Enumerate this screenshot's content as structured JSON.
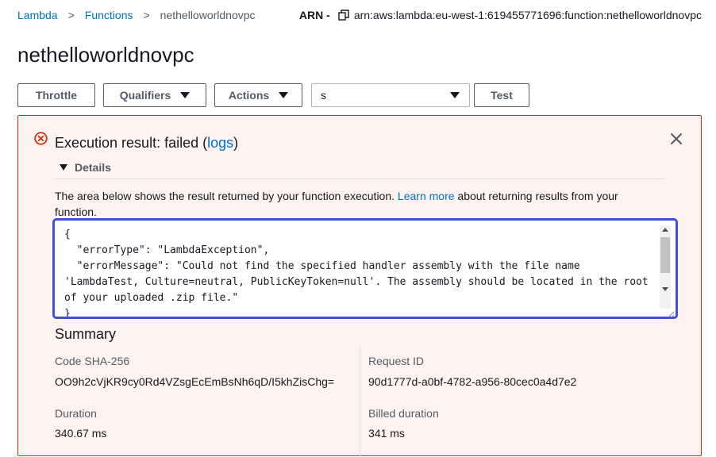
{
  "breadcrumb": {
    "items": [
      "Lambda",
      "Functions"
    ],
    "current": "nethelloworldnovpc",
    "separator": ">"
  },
  "arn": {
    "label": "ARN -",
    "value": "arn:aws:lambda:eu-west-1:619455771696:function:nethelloworldnovpc",
    "icon": "copy-icon"
  },
  "page": {
    "title": "nethelloworldnovpc"
  },
  "toolbar": {
    "throttle_label": "Throttle",
    "qualifiers_label": "Qualifiers",
    "actions_label": "Actions",
    "test_event_selected": "s",
    "test_label": "Test"
  },
  "alert": {
    "title_prefix": "Execution result: failed (",
    "logs_link": "logs",
    "title_suffix": ")",
    "details_label": "Details",
    "description_prefix": "The area below shows the result returned by your function execution. ",
    "learn_more": "Learn more",
    "description_suffix": " about returning results from your function.",
    "result_json": "{\n  \"errorType\": \"LambdaException\",\n  \"errorMessage\": \"Could not find the specified handler assembly with the file name 'LambdaTest, Culture=neutral, PublicKeyToken=null'. The assembly should be located in the root of your uploaded .zip file.\"\n}"
  },
  "summary": {
    "title": "Summary",
    "code_sha_label": "Code SHA-256",
    "code_sha_value": "OO9h2cVjKR9cy0Rd4VZsgEcEmBsNh6qD/I5khZisChg=",
    "request_id_label": "Request ID",
    "request_id_value": "90d1777d-a0bf-4782-a956-80cec0a4d7e2",
    "duration_label": "Duration",
    "duration_value": "340.67 ms",
    "billed_label": "Billed duration",
    "billed_value": "341 ms"
  },
  "colors": {
    "link": "#0073bb",
    "error_border": "#d13212",
    "error_bg": "#fdf3f1",
    "focus_ring": "#3f4fd8"
  }
}
